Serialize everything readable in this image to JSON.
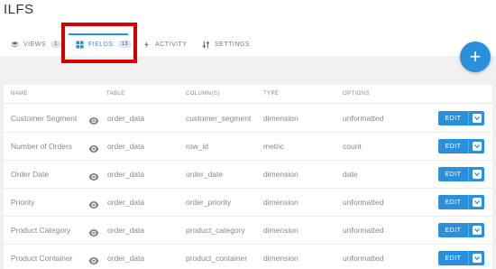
{
  "app": {
    "title": "ILFS"
  },
  "tabs": [
    {
      "label": "VIEWS",
      "count": "1",
      "icon": "layers-icon"
    },
    {
      "label": "FIELDS",
      "count": "13",
      "icon": "grid-icon",
      "active": true
    },
    {
      "label": "ACTIVITY",
      "icon": "bolt-icon"
    },
    {
      "label": "SETTINGS",
      "icon": "sliders-icon"
    }
  ],
  "fab": {
    "label": "+"
  },
  "table": {
    "headers": {
      "name": "NAME",
      "table": "TABLE",
      "columns": "COLUMN(S)",
      "type": "TYPE",
      "options": "OPTIONS"
    },
    "rows": [
      {
        "name": "Customer Segment",
        "table": "order_data",
        "column": "customer_segment",
        "type": "dimension",
        "options": "unformatted",
        "action": "EDIT"
      },
      {
        "name": "Number of Orders",
        "table": "order_data",
        "column": "row_id",
        "type": "metric",
        "options": "count",
        "action": "EDIT"
      },
      {
        "name": "Order Date",
        "table": "order_data",
        "column": "order_date",
        "type": "dimension",
        "options": "date",
        "action": "EDIT"
      },
      {
        "name": "Priority",
        "table": "order_data",
        "column": "order_priority",
        "type": "dimension",
        "options": "unformatted",
        "action": "EDIT"
      },
      {
        "name": "Product Category",
        "table": "order_data",
        "column": "product_category",
        "type": "dimension",
        "options": "unformatted",
        "action": "EDIT"
      },
      {
        "name": "Product Container",
        "table": "order_data",
        "column": "product_container",
        "type": "dimension",
        "options": "unformatted",
        "action": "EDIT"
      }
    ]
  },
  "colors": {
    "accent": "#2a90d9",
    "highlight": "#d40000",
    "background": "#f0f0f0"
  }
}
